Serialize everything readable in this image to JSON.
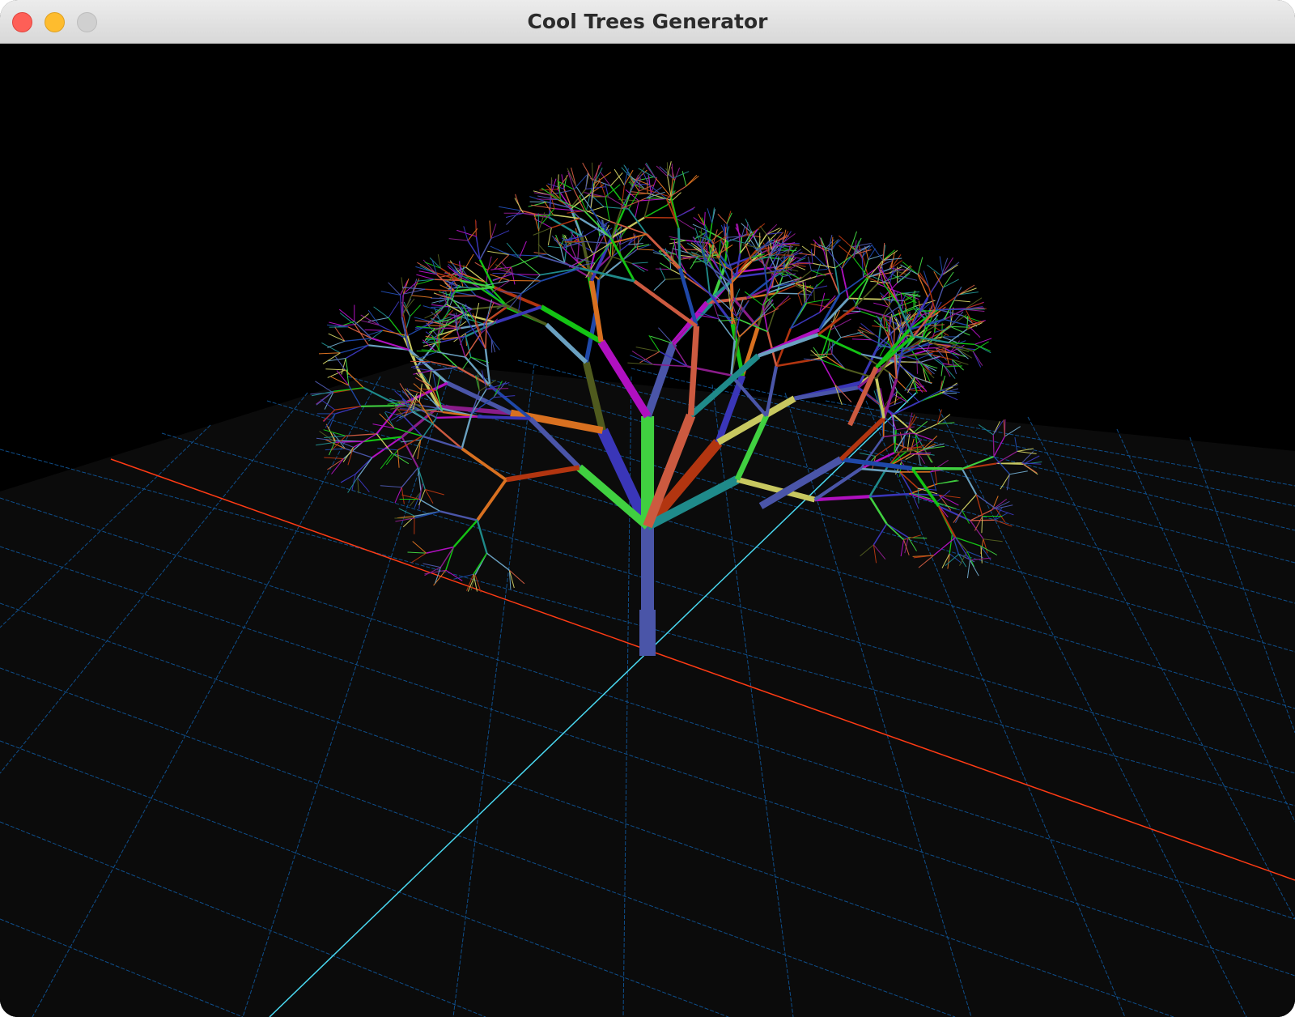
{
  "window": {
    "title": "Cool Trees Generator",
    "controls": [
      "close",
      "minimize",
      "zoom"
    ]
  },
  "scene": {
    "background_color": "#000000",
    "ground_color": "#0b0b0b",
    "grid_color": "#0f4f8c",
    "x_axis_color": "#ff3b14",
    "z_axis_color": "#4ad8f0",
    "tree_colors": [
      "#4a55a8",
      "#1f48a8",
      "#b010c0",
      "#4f5a1e",
      "#b23510",
      "#14c414",
      "#3a36b8",
      "#1f8a8a",
      "#cc5a40",
      "#8a1c8a",
      "#6aa0c0",
      "#c8c860",
      "#40d040",
      "#d87020"
    ]
  }
}
